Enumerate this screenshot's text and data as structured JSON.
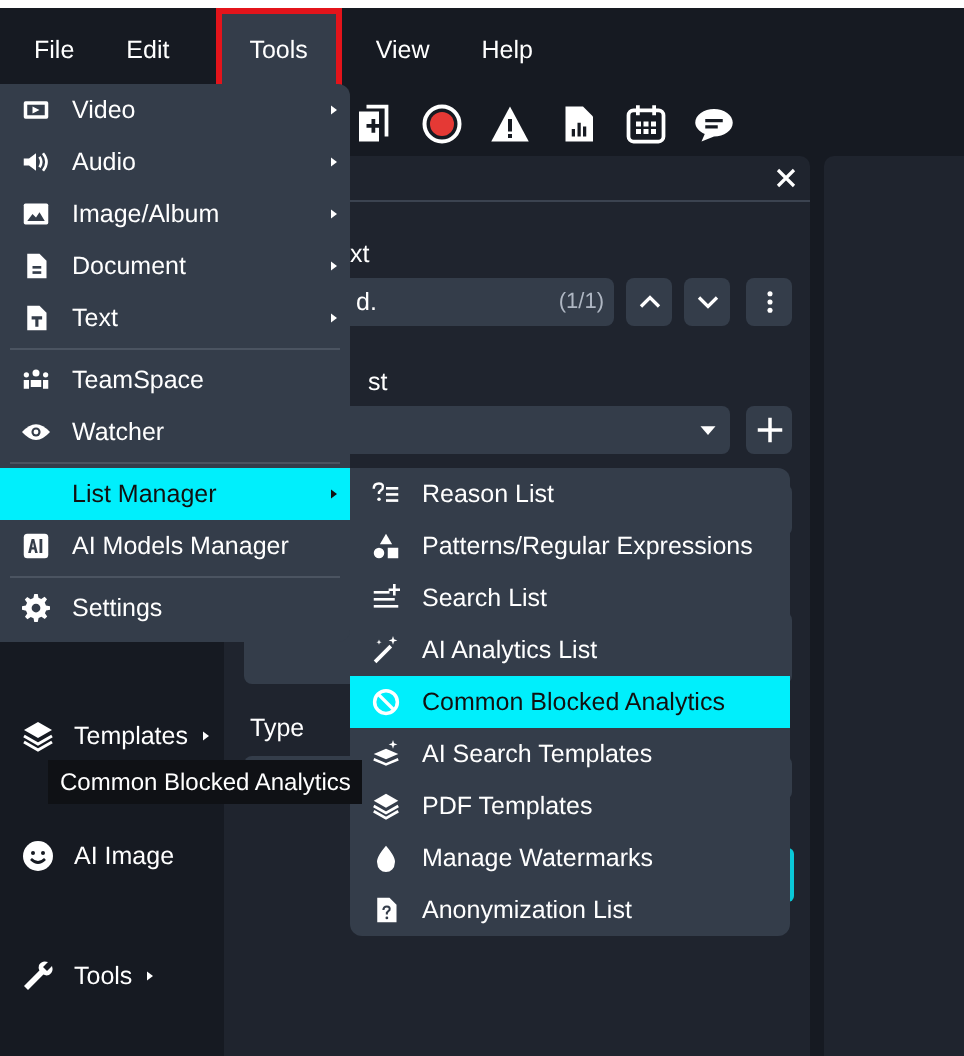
{
  "menubar": [
    {
      "label": "File",
      "selected": false
    },
    {
      "label": "Edit",
      "selected": false
    },
    {
      "label": "Tools",
      "selected": true
    },
    {
      "label": "View",
      "selected": false
    },
    {
      "label": "Help",
      "selected": false
    }
  ],
  "panel": {
    "fields": [
      {
        "label": "xt",
        "value": "d.",
        "counter": "(1/1)"
      },
      {
        "label": "st"
      }
    ],
    "type_label": "Type"
  },
  "sidebar": {
    "items": [
      {
        "label": "Templates",
        "has_submenu": true
      },
      {
        "label": "AI Image",
        "has_submenu": false
      },
      {
        "label": "Tools",
        "has_submenu": true
      }
    ]
  },
  "tools_menu": {
    "groups": [
      [
        {
          "label": "Video",
          "has_submenu": true,
          "selected": false
        },
        {
          "label": "Audio",
          "has_submenu": true,
          "selected": false
        },
        {
          "label": "Image/Album",
          "has_submenu": true,
          "selected": false
        },
        {
          "label": "Document",
          "has_submenu": true,
          "selected": false
        },
        {
          "label": "Text",
          "has_submenu": true,
          "selected": false
        }
      ],
      [
        {
          "label": "TeamSpace",
          "has_submenu": false,
          "selected": false
        },
        {
          "label": "Watcher",
          "has_submenu": false,
          "selected": false
        }
      ],
      [
        {
          "label": "List Manager",
          "has_submenu": true,
          "selected": true
        },
        {
          "label": "AI Models Manager",
          "has_submenu": false,
          "selected": false
        }
      ],
      [
        {
          "label": "Settings",
          "has_submenu": false,
          "selected": false
        }
      ]
    ]
  },
  "submenu": {
    "items": [
      {
        "label": "Reason List",
        "selected": false
      },
      {
        "label": "Patterns/Regular Expressions",
        "selected": false
      },
      {
        "label": "Search List",
        "selected": false
      },
      {
        "label": "AI Analytics List",
        "selected": false
      },
      {
        "label": "Common Blocked Analytics",
        "selected": true
      },
      {
        "label": "AI Search Templates",
        "selected": false
      },
      {
        "label": "PDF Templates",
        "selected": false
      },
      {
        "label": "Manage Watermarks",
        "selected": false
      },
      {
        "label": "Anonymization List",
        "selected": false
      }
    ]
  },
  "tooltip": {
    "text": "Common Blocked Analytics"
  }
}
